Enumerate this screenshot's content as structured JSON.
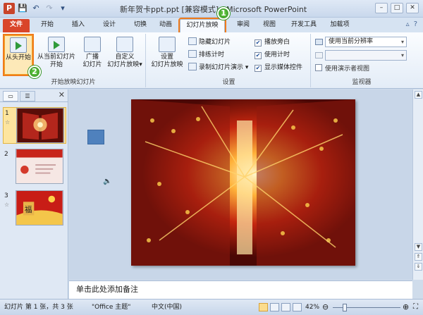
{
  "title_bar": {
    "title": "新年贺卡ppt.ppt [兼容模式] - Microsoft PowerPoint",
    "app_icon_letter": "P",
    "qat_icons": [
      "save-icon",
      "undo-icon",
      "redo-icon",
      "customize-qat-icon"
    ],
    "window_buttons": [
      "minimize",
      "maximize",
      "close"
    ]
  },
  "tabs": [
    "文件",
    "开始",
    "插入",
    "设计",
    "切换",
    "动画",
    "幻灯片放映",
    "审阅",
    "视图",
    "开发工具",
    "加载项"
  ],
  "active_tab": "幻灯片放映",
  "ribbon": {
    "group_start": {
      "label": "开始放映幻灯片",
      "from_beginning": "从头开始",
      "from_current_line1": "从当前幻灯片",
      "from_current_line2": "开始",
      "broadcast_line1": "广播",
      "broadcast_line2": "幻灯片",
      "custom_line1": "自定义",
      "custom_line2": "幻灯片放映"
    },
    "group_setup": {
      "label": "设置",
      "setup_line1": "设置",
      "setup_line2": "幻灯片放映",
      "hide_slide": "隐藏幻灯片",
      "rehearse": "排练计时",
      "record": "录制幻灯片演示",
      "play_narrations": "播放旁白",
      "use_timings": "使用计时",
      "show_media_controls": "显示媒体控件",
      "play_narrations_checked": true,
      "use_timings_checked": true,
      "show_media_controls_checked": true
    },
    "group_monitors": {
      "label": "监视器",
      "resolution": "使用当前分辨率",
      "show_on": "",
      "presenter_view": "使用演示者视图",
      "presenter_view_checked": false
    }
  },
  "callouts": [
    "1",
    "2"
  ],
  "slides": [
    {
      "number": "1",
      "has_animation": "☆",
      "selected": true
    },
    {
      "number": "2",
      "has_animation": "",
      "selected": false
    },
    {
      "number": "3",
      "has_animation": "☆",
      "selected": false
    }
  ],
  "slide3_text": "福",
  "notes_placeholder": "单击此处添加备注",
  "status_bar": {
    "slide_info": "幻灯片 第 1 张，共 3 张",
    "theme": "\"Office 主题\"",
    "language": "中文(中国)",
    "zoom": "42%",
    "zoom_value": 0.42
  },
  "colors": {
    "file_tab": "#d9452a",
    "highlight": "#f07b1c",
    "selected_thumb": "#fde59e",
    "callout_green": "#2f8f1f"
  }
}
